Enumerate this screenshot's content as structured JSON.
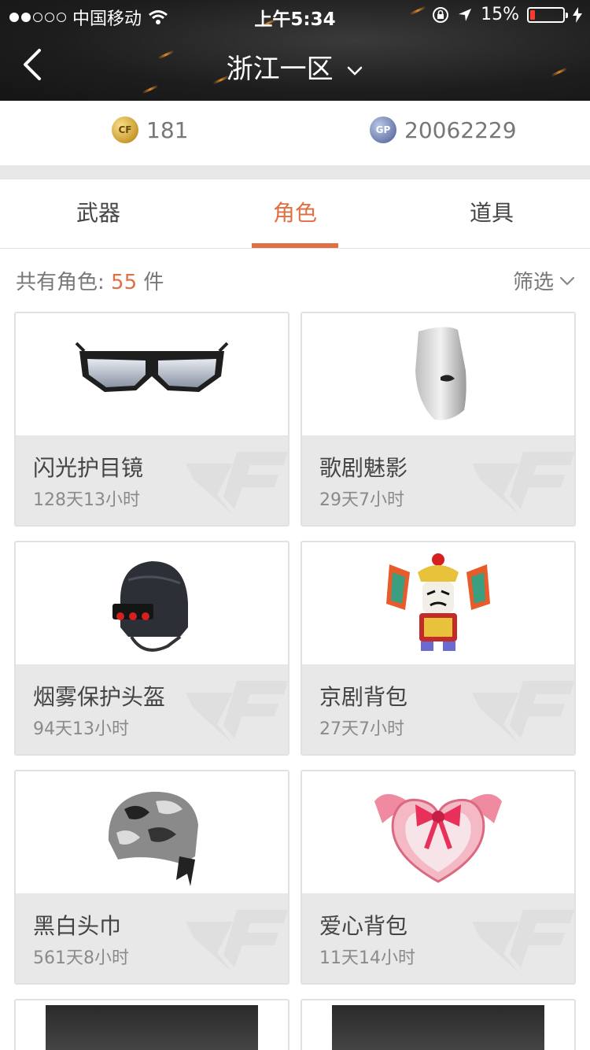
{
  "status_bar": {
    "carrier": "中国移动",
    "time": "上午5:34",
    "battery": "15%",
    "battery_level": 0.15
  },
  "nav": {
    "title": "浙江一区",
    "back_icon": "chevron-left-icon",
    "title_icon": "chevron-down-icon"
  },
  "currency": {
    "cf_points": "181",
    "gp_points": "20062229",
    "cf_icon_label": "CF",
    "gp_icon_label": "GP"
  },
  "tabs": [
    {
      "label": "武器",
      "active": false
    },
    {
      "label": "角色",
      "active": true
    },
    {
      "label": "道具",
      "active": false
    }
  ],
  "summary": {
    "prefix": "共有角色: ",
    "count": "55",
    "suffix": " 件",
    "filter_label": "筛选"
  },
  "items": [
    {
      "name": "闪光护目镜",
      "time": "128天13小时",
      "icon": "goggles-icon"
    },
    {
      "name": "歌剧魅影",
      "time": "29天7小时",
      "icon": "mask-icon"
    },
    {
      "name": "烟雾保护头盔",
      "time": "94天13小时",
      "icon": "helmet-icon"
    },
    {
      "name": "京剧背包",
      "time": "27天7小时",
      "icon": "opera-backpack-icon"
    },
    {
      "name": "黑白头巾",
      "time": "561天8小时",
      "icon": "bandana-icon"
    },
    {
      "name": "爱心背包",
      "time": "11天14小时",
      "icon": "heart-backpack-icon"
    }
  ],
  "colors": {
    "accent": "#e07043",
    "header_bg": "#1d1d1d",
    "card_info_bg": "#e8e8e8"
  }
}
